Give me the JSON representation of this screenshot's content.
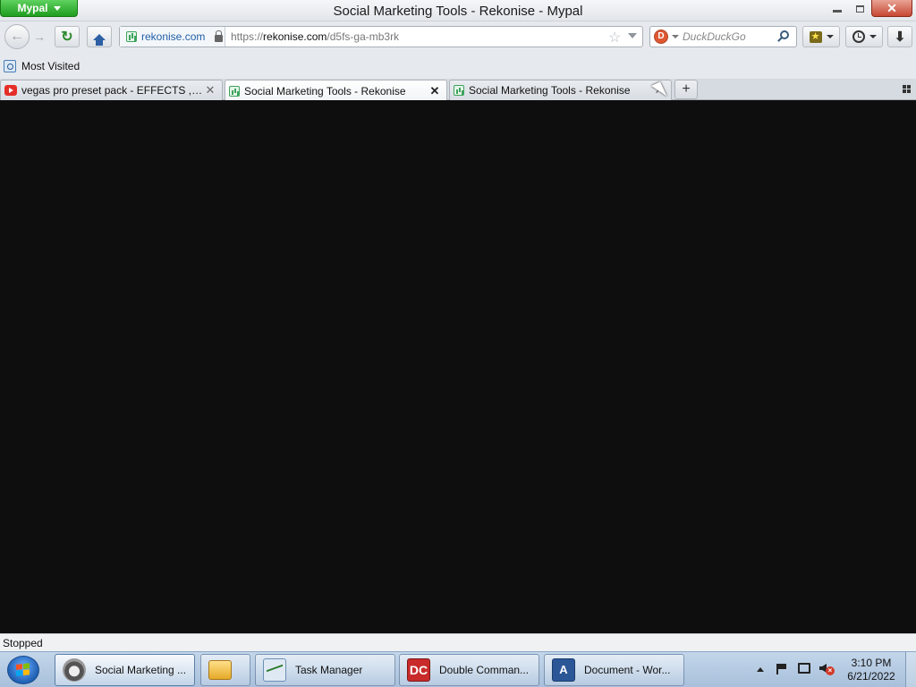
{
  "window": {
    "title": "Social Marketing Tools - Rekonise - Mypal",
    "app_menu_label": "Mypal",
    "close_glyph": "✕"
  },
  "navbar": {
    "back_glyph": "←",
    "forward_glyph": "→",
    "reload_glyph": "↻",
    "identity_host": "rekonise.com",
    "url_scheme": "https://",
    "url_host": "rekonise.com",
    "url_path": "/d5fs-ga-mb3rk",
    "bookmark_star_glyph": "☆",
    "search_placeholder": "DuckDuckGo",
    "download_glyph": "⬇"
  },
  "bookmarks_bar": {
    "items": [
      {
        "label": "Most Visited",
        "icon": "most-visited-icon"
      }
    ]
  },
  "tabs": [
    {
      "label": "vegas pro preset pack - EFFECTS , SH...",
      "icon": "youtube-icon",
      "selected": false,
      "close": "✕"
    },
    {
      "label": "Social Marketing Tools - Rekonise",
      "icon": "rekonise-icon",
      "selected": true,
      "close": "✕"
    },
    {
      "label": "Social Marketing Tools - Rekonise",
      "icon": "rekonise-icon",
      "selected": false,
      "close": "✕"
    }
  ],
  "newtab_glyph": "+",
  "status": {
    "text": "Stopped"
  },
  "taskbar": {
    "items": [
      {
        "label": "Social Marketing ...",
        "icon": "mypal-raccoon-icon",
        "active": true
      },
      {
        "label": "",
        "icon": "windows-explorer-icon",
        "active": false
      },
      {
        "label": "Task Manager",
        "icon": "task-manager-icon",
        "active": false
      },
      {
        "label": "Double Comman...",
        "icon": "double-commander-icon",
        "icon_text": "DC",
        "active": false
      },
      {
        "label": "Document - Wor...",
        "icon": "word-document-icon",
        "icon_text": "A",
        "active": false
      }
    ],
    "tray": {
      "time": "3:10 PM",
      "date": "6/21/2022"
    }
  },
  "colors": {
    "content_background": "#0e0e0e",
    "app_button": "#1f9d1f",
    "close_button": "#c74733"
  }
}
